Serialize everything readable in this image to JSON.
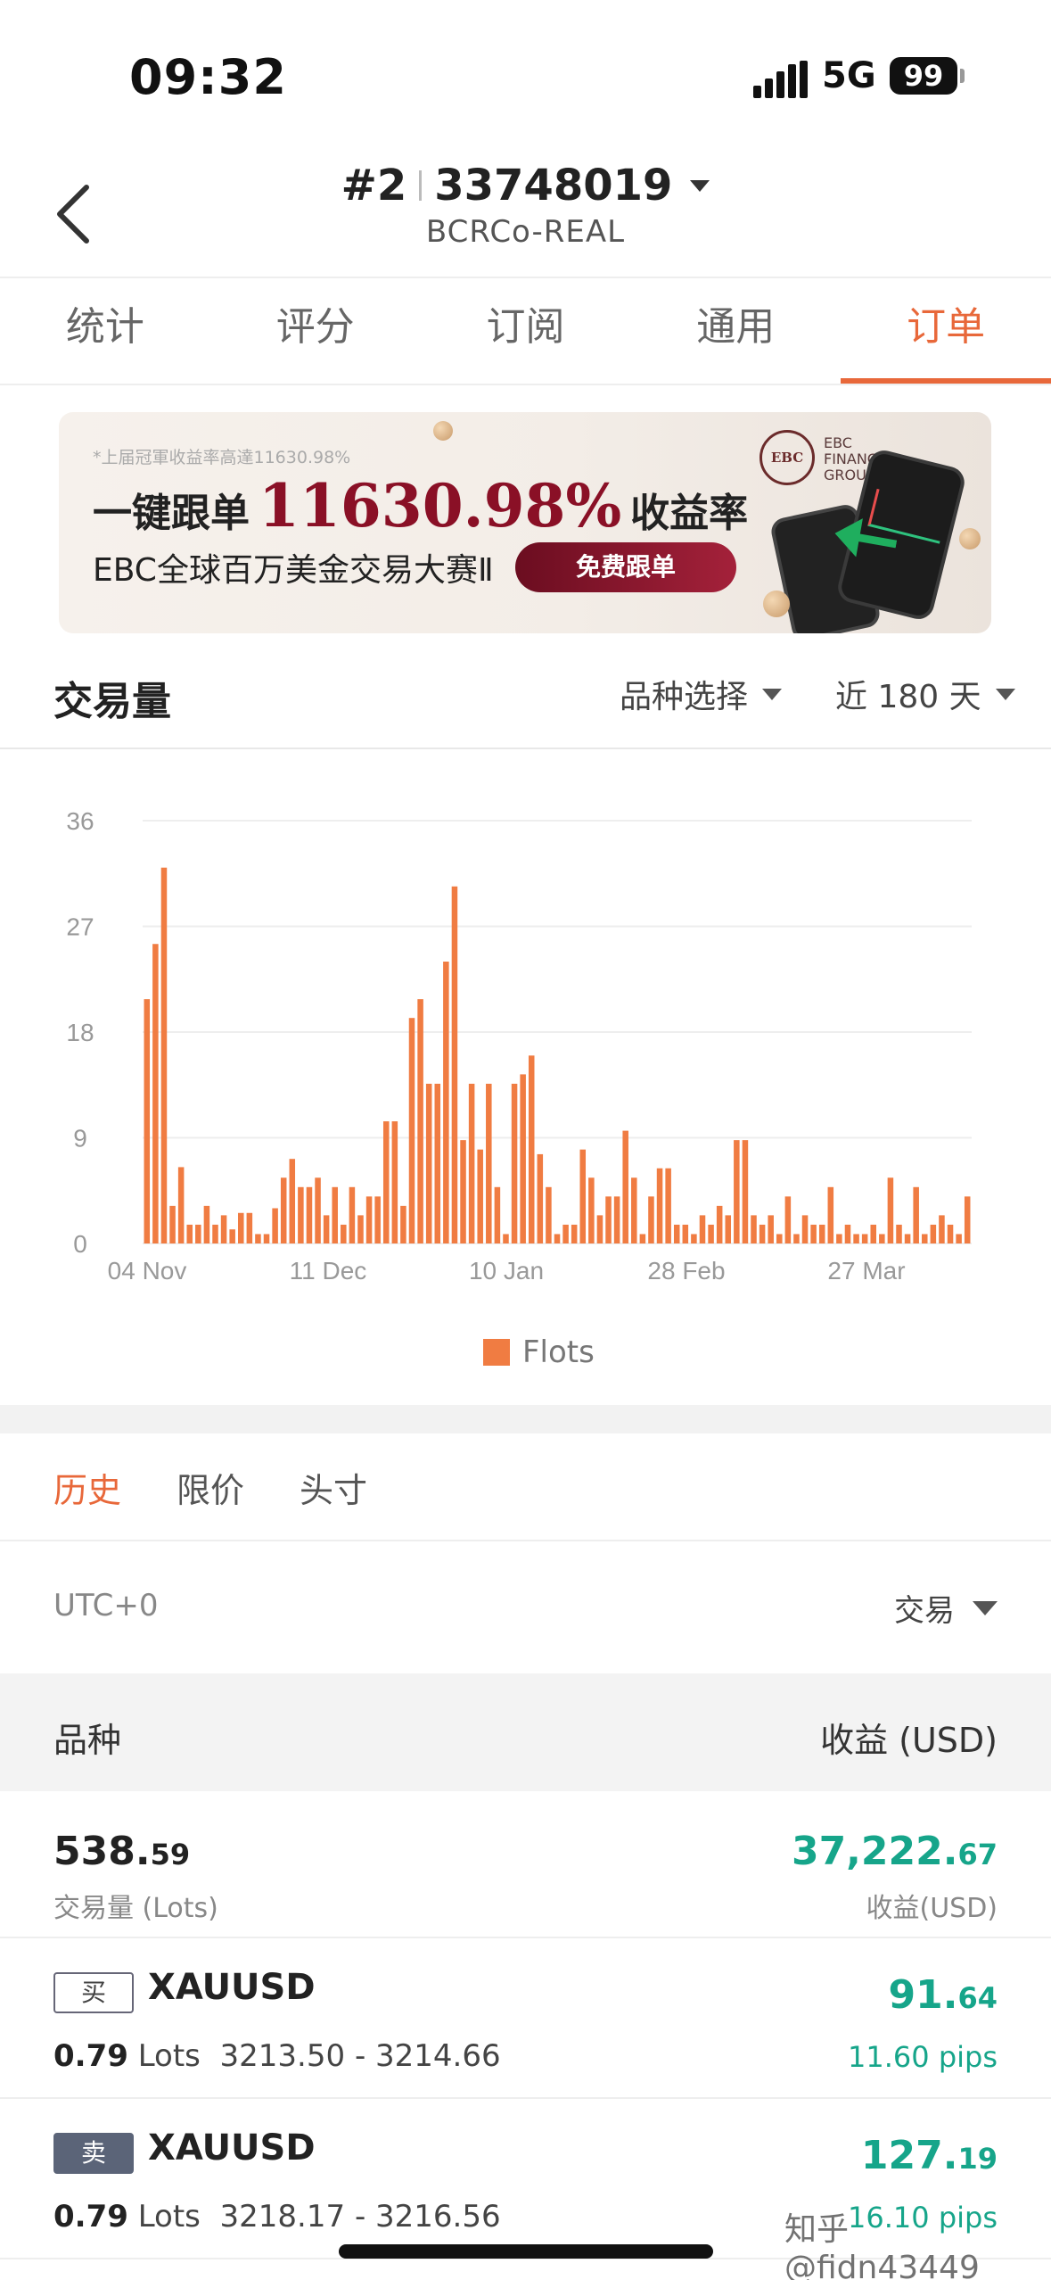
{
  "status_bar": {
    "time": "09:32",
    "network": "5G",
    "battery": "99"
  },
  "header": {
    "account_prefix": "#2",
    "account_number": "33748019",
    "server": "BCRCo-REAL"
  },
  "tabs": [
    {
      "label": "统计"
    },
    {
      "label": "评分"
    },
    {
      "label": "订阅"
    },
    {
      "label": "通用"
    },
    {
      "label": "订单",
      "active": true
    }
  ],
  "banner": {
    "note": "*上届冠軍收益率高達11630.98%",
    "headline_left": "一键跟单",
    "headline_percent": "11630.98%",
    "headline_right": "收益率",
    "subtitle": "EBC全球百万美金交易大赛Ⅱ",
    "button": "免费跟单",
    "logo_mark": "EBC",
    "logo_text": [
      "EBC",
      "FINANCIAL",
      "GROUP"
    ]
  },
  "volume": {
    "title": "交易量",
    "symbol_filter": "品种选择",
    "period_filter": "近 180 天"
  },
  "chart_data": {
    "type": "bar",
    "y_ticks": [
      "36",
      "27",
      "18",
      "9",
      "0"
    ],
    "ylim": [
      0,
      36
    ],
    "x_ticks": [
      "04 Nov",
      "11 Dec",
      "10 Jan",
      "28 Feb",
      "27 Mar"
    ],
    "legend": "Flots",
    "color": "#f07c42",
    "values": [
      20.8,
      25.5,
      32,
      3.2,
      6.5,
      1.6,
      1.6,
      3.2,
      1.6,
      2.4,
      1.2,
      2.6,
      2.6,
      0.8,
      0.8,
      3,
      5.6,
      7.2,
      4.8,
      4.8,
      5.6,
      2.4,
      4.8,
      1.6,
      4.8,
      2.4,
      4,
      4,
      10.4,
      10.4,
      3.2,
      19.2,
      20.8,
      13.6,
      13.6,
      24,
      30.4,
      8.8,
      13.6,
      8,
      13.6,
      4.8,
      0.8,
      13.6,
      14.4,
      16,
      7.6,
      4.8,
      0.8,
      1.6,
      1.6,
      8,
      5.6,
      2.4,
      4,
      4,
      9.6,
      5.6,
      0.8,
      4,
      6.4,
      6.4,
      1.6,
      1.6,
      0.8,
      2.4,
      1.6,
      3.2,
      2.4,
      8.8,
      8.8,
      2.4,
      1.6,
      2.4,
      0.8,
      4,
      0.8,
      2.4,
      1.6,
      1.6,
      4.8,
      0.8,
      1.6,
      0.8,
      0.8,
      1.6,
      0.8,
      5.6,
      1.6,
      0.8,
      4.8,
      0.8,
      1.6,
      2.4,
      1.6,
      0.8,
      4
    ]
  },
  "history": {
    "subtabs": [
      {
        "label": "历史",
        "active": true
      },
      {
        "label": "限价"
      },
      {
        "label": "头寸"
      }
    ],
    "timezone": "UTC+0",
    "filter": "交易",
    "col_symbol": "品种",
    "col_profit": "收益 (USD)",
    "summary": {
      "lots_int": "538.",
      "lots_dec": "59",
      "lots_caption": "交易量 (Lots)",
      "profit_int": "37,222.",
      "profit_dec": "67",
      "profit_caption": "收益(USD)"
    },
    "orders": [
      {
        "side": "买",
        "side_type": "buy",
        "symbol": "XAUUSD",
        "lots": "0.79",
        "lots_unit": "Lots",
        "prices": "3213.50 - 3214.66",
        "profit_int": "91.",
        "profit_dec": "64",
        "pips": "11.60 pips"
      },
      {
        "side": "卖",
        "side_type": "sell",
        "symbol": "XAUUSD",
        "lots": "0.79",
        "lots_unit": "Lots",
        "prices": "3218.17 - 3216.56",
        "profit_int": "127.",
        "profit_dec": "19",
        "pips": "16.10 pips"
      }
    ]
  },
  "watermark": "知乎 @fidn43449"
}
